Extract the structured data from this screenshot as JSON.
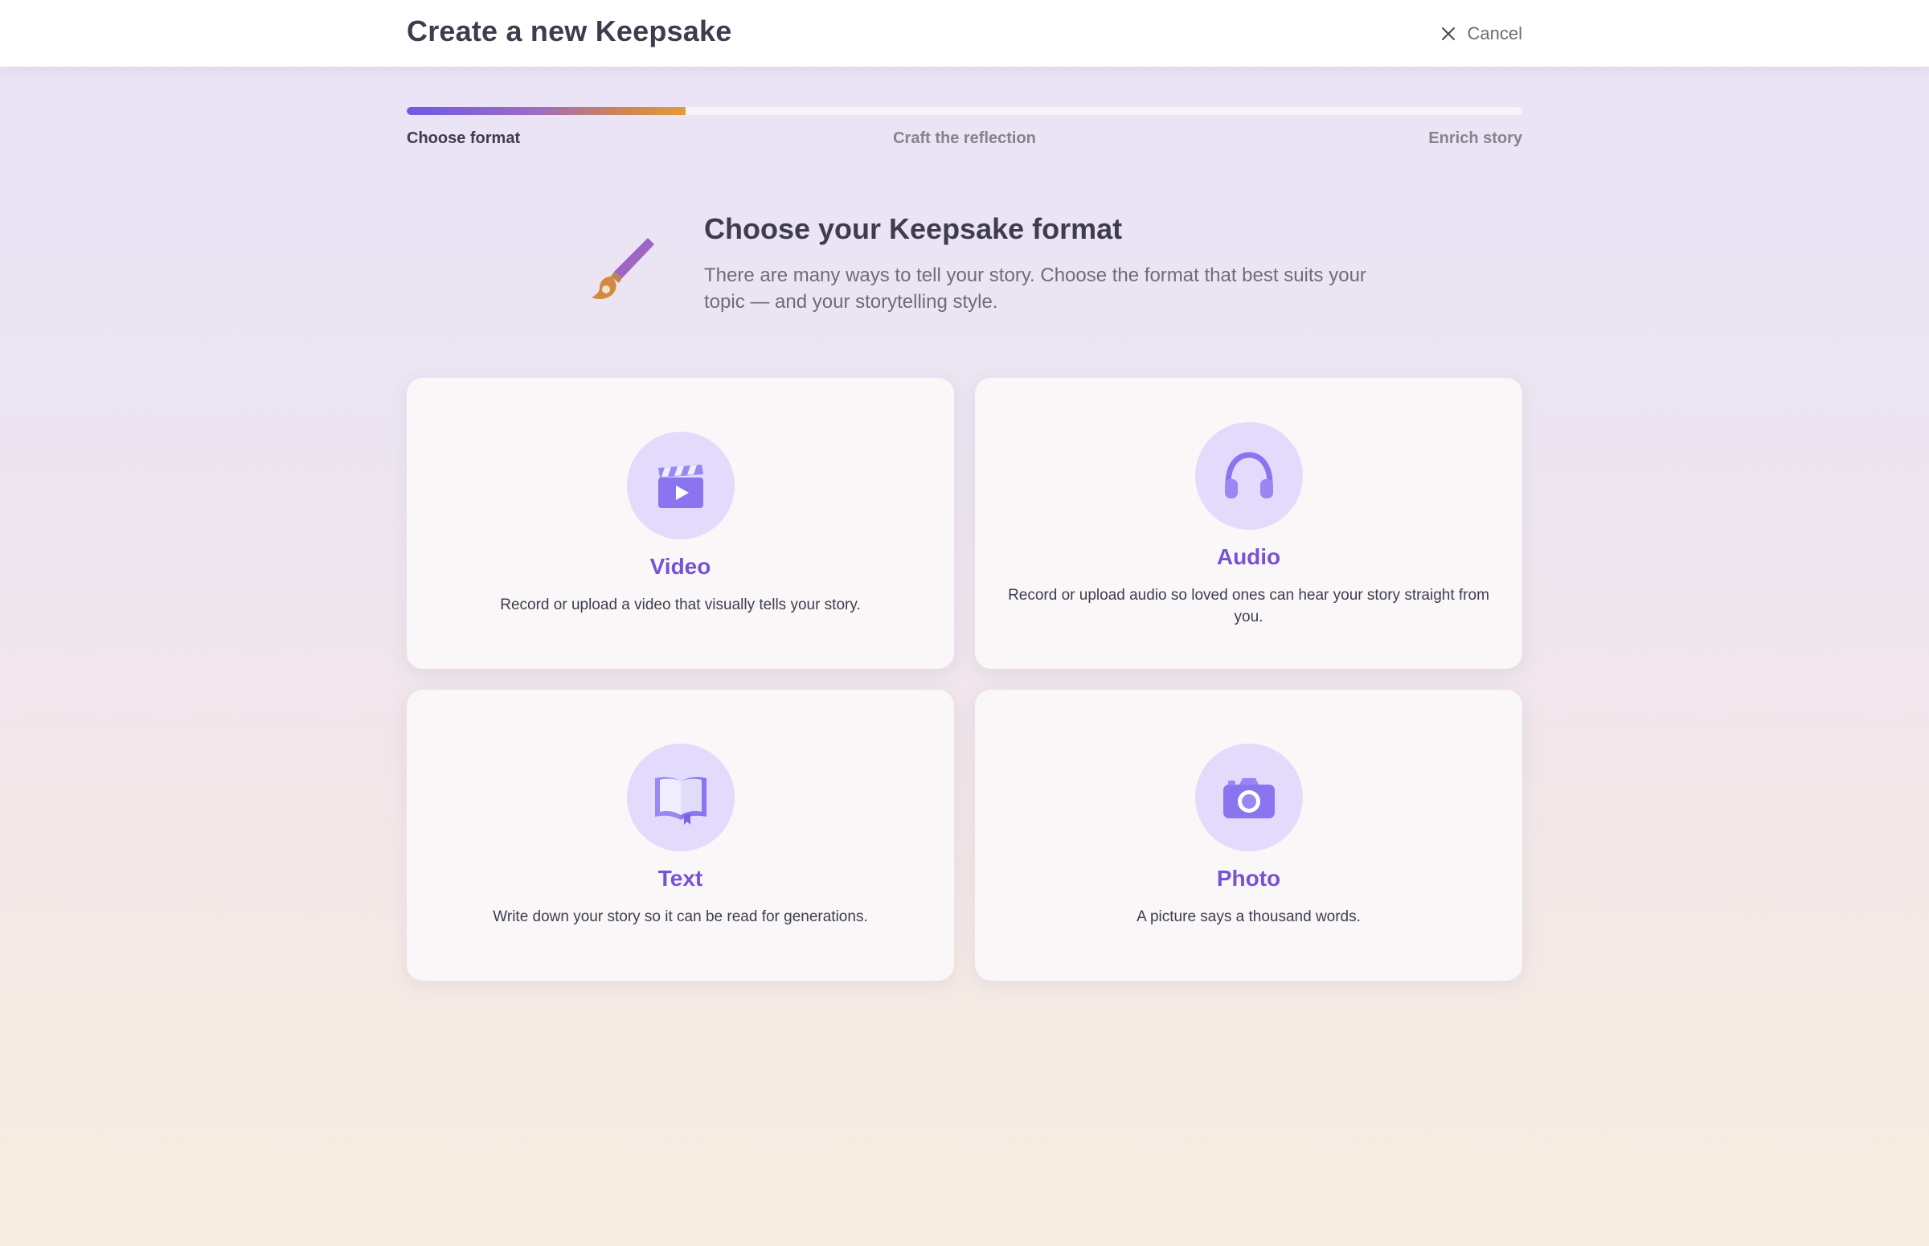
{
  "header": {
    "title": "Create a new Keepsake",
    "cancel_label": "Cancel"
  },
  "progress": {
    "fill_fraction": 0.25,
    "steps": [
      "Choose format",
      "Craft the reflection",
      "Enrich story"
    ],
    "active_step": 0
  },
  "intro": {
    "heading": "Choose your Keepsake format",
    "description": "There are many ways to tell your story. Choose the format that best suits your topic — and your storytelling style."
  },
  "formats": [
    {
      "icon": "clapperboard-icon",
      "label": "Video",
      "description": "Record or upload a video that visually tells your story."
    },
    {
      "icon": "headphones-icon",
      "label": "Audio",
      "description": "Record or upload audio so loved ones can hear your story straight from you."
    },
    {
      "icon": "open-book-icon",
      "label": "Text",
      "description": "Write down your story so it can be read for generations."
    },
    {
      "icon": "camera-icon",
      "label": "Photo",
      "description": "A picture says a thousand words."
    }
  ],
  "colors": {
    "accent": "#7552d6",
    "icon_bg": "#e2dbfb",
    "progress_start": "#6e5ae6",
    "progress_end": "#e29a3e"
  }
}
